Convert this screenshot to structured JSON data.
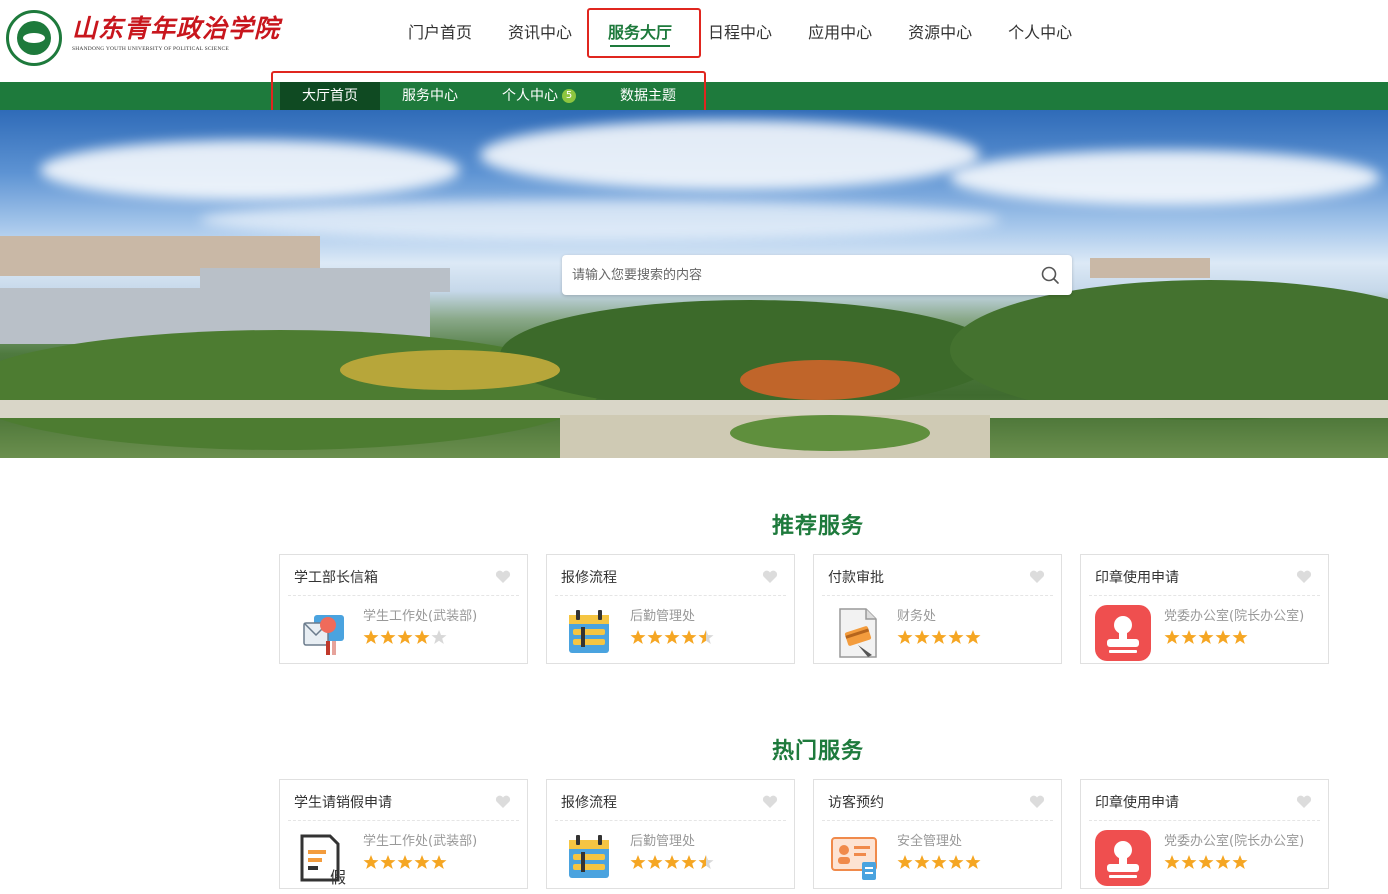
{
  "header": {
    "logo": {
      "name_cn": "山东青年政治学院",
      "name_en": "SHANDONG YOUTH UNIVERSITY OF POLITICAL SCIENCE"
    },
    "nav": [
      {
        "label": "门户首页"
      },
      {
        "label": "资讯中心"
      },
      {
        "label": "服务大厅",
        "active": true
      },
      {
        "label": "日程中心"
      },
      {
        "label": "应用中心"
      },
      {
        "label": "资源中心"
      },
      {
        "label": "个人中心"
      }
    ]
  },
  "subnav": [
    {
      "label": "大厅首页",
      "active": true
    },
    {
      "label": "服务中心"
    },
    {
      "label": "个人中心",
      "badge": "5"
    },
    {
      "label": "数据主题"
    }
  ],
  "search": {
    "placeholder": "请输入您要搜索的内容"
  },
  "colors": {
    "brand_green": "#1e7a3c",
    "highlight_red": "#e0261f",
    "star": "#f5a623",
    "badge": "#8dc63f"
  },
  "sections": [
    {
      "title": "推荐服务",
      "cards": [
        {
          "title": "学工部长信箱",
          "dept": "学生工作处(武装部)",
          "rating": 4,
          "icon": "mailbox-icon"
        },
        {
          "title": "报修流程",
          "dept": "后勤管理处",
          "rating": 4.5,
          "icon": "repair-icon"
        },
        {
          "title": "付款审批",
          "dept": "财务处",
          "rating": 5,
          "icon": "payment-doc-icon"
        },
        {
          "title": "印章使用申请",
          "dept": "党委办公室(院长办公室)",
          "rating": 5,
          "icon": "seal-stamp-icon"
        }
      ]
    },
    {
      "title": "热门服务",
      "cards": [
        {
          "title": "学生请销假申请",
          "dept": "学生工作处(武装部)",
          "rating": 5,
          "icon": "leave-request-icon"
        },
        {
          "title": "报修流程",
          "dept": "后勤管理处",
          "rating": 4.5,
          "icon": "repair-icon"
        },
        {
          "title": "访客预约",
          "dept": "安全管理处",
          "rating": 5,
          "icon": "visitor-card-icon"
        },
        {
          "title": "印章使用申请",
          "dept": "党委办公室(院长办公室)",
          "rating": 5,
          "icon": "seal-stamp-icon"
        }
      ]
    }
  ]
}
